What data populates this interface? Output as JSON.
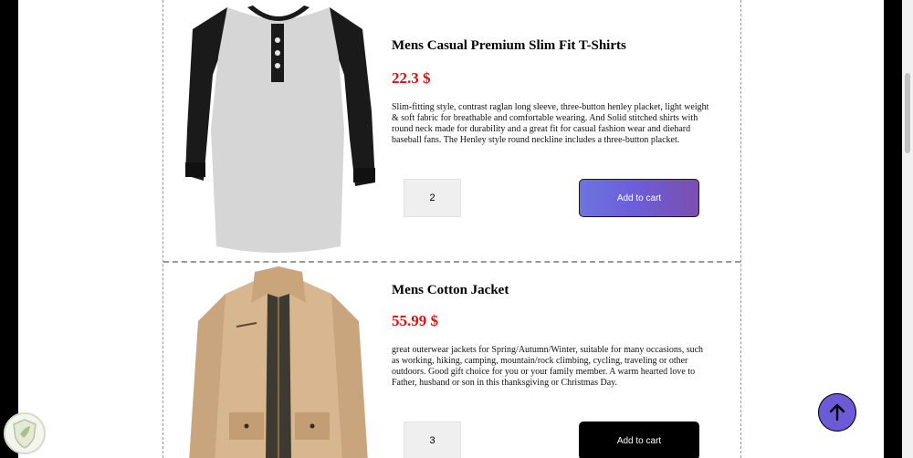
{
  "products": [
    {
      "title": "Mens Casual Premium Slim Fit T-Shirts",
      "price": "22.3 $",
      "description": "Slim-fitting style, contrast raglan long sleeve, three-button henley placket, light weight & soft fabric for breathable and comfortable wearing. And Solid stitched shirts with round neck made for durability and a great fit for casual fashion wear and diehard baseball fans. The Henley style round neckline includes a three-button placket.",
      "quantity": "2",
      "add_label": "Add to cart"
    },
    {
      "title": "Mens Cotton Jacket",
      "price": "55.99 $",
      "description": "great outerwear jackets for Spring/Autumn/Winter, suitable for many occasions, such as working, hiking, camping, mountain/rock climbing, cycling, traveling or other outdoors. Good gift choice for you or your family member. A warm hearted love to Father, husband or son in this thanksgiving or Christmas Day.",
      "quantity": "3",
      "add_label": "Add to cart"
    }
  ],
  "icons": {
    "scroll_top": "arrow-up-icon",
    "badge": "shield-leaf-icon"
  },
  "colors": {
    "price": "#e01010",
    "button_gradient_start": "#6c74e0",
    "button_gradient_end": "#7a4fae",
    "button_solid": "#000000",
    "scroll_top": "#6b5bd6"
  }
}
